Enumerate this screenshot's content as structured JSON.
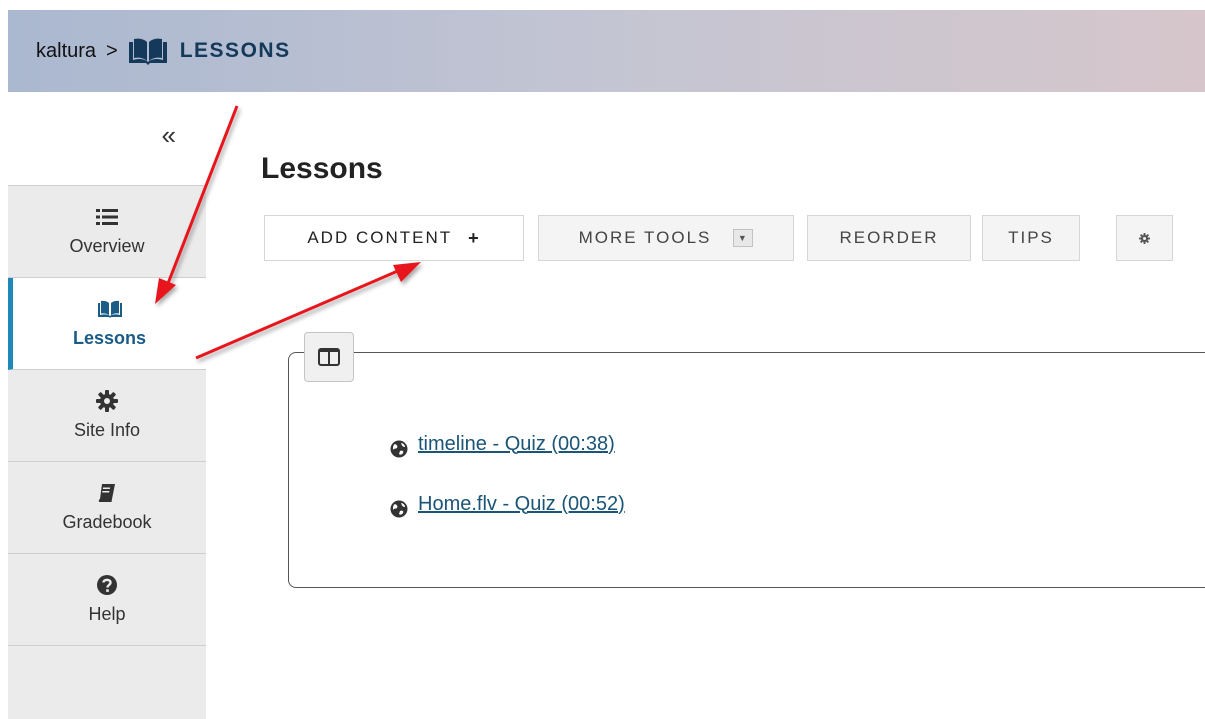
{
  "breadcrumb": {
    "site": "kaltura",
    "separator": ">",
    "tool": "LESSONS"
  },
  "sidebar": {
    "collapse_icon": "double-chevron-left-icon",
    "items": [
      {
        "label": "Overview",
        "icon": "list-icon"
      },
      {
        "label": "Lessons",
        "icon": "book-open-icon",
        "active": true
      },
      {
        "label": "Site Info",
        "icon": "gear-icon"
      },
      {
        "label": "Gradebook",
        "icon": "book-icon"
      },
      {
        "label": "Help",
        "icon": "question-circle-icon"
      }
    ]
  },
  "main": {
    "title": "Lessons",
    "toolbar": {
      "add_content": "ADD CONTENT",
      "add_symbol": "+",
      "more_tools": "MORE TOOLS",
      "reorder": "REORDER",
      "tips": "TIPS"
    },
    "items": [
      {
        "label": "timeline - Quiz (00:38)",
        "icon": "globe-icon"
      },
      {
        "label": "Home.flv - Quiz (00:52)",
        "icon": "globe-icon"
      }
    ]
  },
  "colors": {
    "active_accent": "#1e88b8",
    "link": "#1a5577",
    "annotation_arrow": "#e8171b"
  }
}
